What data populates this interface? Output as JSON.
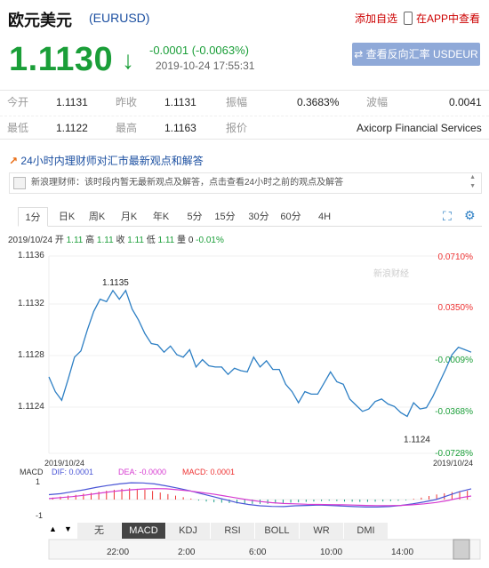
{
  "header": {
    "title": "欧元美元",
    "code": "(EURUSD)",
    "add_label": "添加自选",
    "app_label": "在APP中查看"
  },
  "quote": {
    "price": "1.1130",
    "arrow": "↓",
    "change": "-0.0001 (-0.0063%)",
    "datetime": "2019-10-24 17:55:31",
    "inverse_button": "⇄ 查看反向汇率 USDEUR"
  },
  "stats": {
    "row1": [
      {
        "label": "今开",
        "value": "1.1131"
      },
      {
        "label": "昨收",
        "value": "1.1131"
      },
      {
        "label": "振幅",
        "value": "0.3683%"
      },
      {
        "label": "波幅",
        "value": "0.0041"
      }
    ],
    "row2": [
      {
        "label": "最低",
        "value": "1.1122"
      },
      {
        "label": "最高",
        "value": "1.1163"
      },
      {
        "label": "报价",
        "value": "Axicorp Financial Services"
      }
    ]
  },
  "expert": {
    "title": "24小时内理财师对汇市最新观点和解答",
    "message": "新浪理财师：该时段内暂无最新观点及解答，点击查看24小时之前的观点及解答"
  },
  "tabs": [
    "1分",
    "日K",
    "周K",
    "月K",
    "年K",
    "5分",
    "15分",
    "30分",
    "60分",
    "4H"
  ],
  "active_tab": "1分",
  "info_bar": {
    "date": "2019/10/24",
    "open_label": "开",
    "open": "1.11",
    "high_label": "高",
    "high": "1.11",
    "close_label": "收",
    "close": "1.11",
    "low_label": "低",
    "low": "1.11",
    "volume_label": "量",
    "volume": "0",
    "change": "-0.01%"
  },
  "chart_data": {
    "type": "line",
    "ylim": [
      1.1122,
      1.1138
    ],
    "y_ticks": [
      "1.1136",
      "1.1132",
      "1.1128",
      "1.1124"
    ],
    "right_ticks": [
      "0.0710%",
      "0.0350%",
      "-0.0009%",
      "-0.0368%",
      "-0.0728%"
    ],
    "high_label": "1.1135",
    "low_label": "1.1124",
    "watermark": "新浪财经",
    "series": [
      {
        "values": [
          1.11282,
          1.1127,
          1.11263,
          1.1128,
          1.11298,
          1.11303,
          1.1132,
          1.11335,
          1.11345,
          1.11343,
          1.11352,
          1.11345,
          1.11352,
          1.11337,
          1.11328,
          1.11317,
          1.11309,
          1.11308,
          1.11302,
          1.11307,
          1.113,
          1.11298,
          1.11304,
          1.1129,
          1.11296,
          1.11291,
          1.1129,
          1.1129,
          1.11284,
          1.11289,
          1.11287,
          1.11286,
          1.11298,
          1.1129,
          1.11295,
          1.11288,
          1.11288,
          1.11276,
          1.1127,
          1.11261,
          1.1127,
          1.11268,
          1.11268,
          1.11277,
          1.11286,
          1.11278,
          1.11276,
          1.11264,
          1.11259,
          1.11254,
          1.11256,
          1.11262,
          1.11264,
          1.1126,
          1.11258,
          1.11253,
          1.1125,
          1.11261,
          1.11256,
          1.11257,
          1.11266,
          1.11277,
          1.11288,
          1.113,
          1.11306,
          1.11304,
          1.11302
        ]
      }
    ]
  },
  "macd": {
    "label": "MACD",
    "dif": "DIF: 0.0001",
    "dea": "DEA: -0.0000",
    "macd": "MACD: 0.0001",
    "date_left": "2019/10/24",
    "date_right": "2019/10/24",
    "ticks": [
      "1",
      "-1"
    ],
    "bars": [
      0.1,
      0.15,
      0.2,
      0.24,
      0.3,
      0.34,
      0.4,
      0.45,
      0.5,
      0.55,
      0.58,
      0.55,
      0.5,
      0.44,
      0.36,
      0.28,
      0.2,
      0.12,
      0.05,
      -0.05,
      -0.1,
      -0.14,
      -0.16,
      -0.18,
      -0.2,
      -0.21,
      -0.22,
      -0.22,
      -0.22,
      -0.2,
      -0.18,
      -0.16,
      -0.14,
      -0.12,
      -0.1,
      -0.08,
      -0.06,
      -0.08,
      -0.1,
      -0.11,
      -0.12,
      -0.12,
      -0.11,
      -0.1,
      -0.08,
      -0.06,
      -0.04,
      0.04,
      0.1,
      0.18,
      0.26,
      0.32,
      0.38,
      0.42,
      0.45
    ],
    "dif_line": [
      0.25,
      0.3,
      0.4,
      0.5,
      0.62,
      0.72,
      0.8,
      0.86,
      0.85,
      0.8,
      0.7,
      0.58,
      0.45,
      0.3,
      0.15,
      0.0,
      -0.15,
      -0.25,
      -0.32,
      -0.35,
      -0.36,
      -0.32,
      -0.3,
      -0.28,
      -0.3,
      -0.33,
      -0.36,
      -0.38,
      -0.38,
      -0.36,
      -0.3,
      -0.22,
      -0.12,
      0.0,
      0.2,
      0.4,
      0.55
    ],
    "dea_line": [
      0.05,
      0.1,
      0.15,
      0.22,
      0.3,
      0.38,
      0.45,
      0.5,
      0.54,
      0.56,
      0.55,
      0.5,
      0.44,
      0.36,
      0.28,
      0.18,
      0.08,
      -0.02,
      -0.1,
      -0.16,
      -0.2,
      -0.22,
      -0.24,
      -0.25,
      -0.26,
      -0.27,
      -0.28,
      -0.3,
      -0.31,
      -0.31,
      -0.3,
      -0.27,
      -0.22,
      -0.15,
      -0.05,
      0.08,
      0.18
    ]
  },
  "bottom_tabs": [
    "无",
    "MACD",
    "KDJ",
    "RSI",
    "BOLL",
    "WR",
    "DMI"
  ],
  "bottom_active": "MACD",
  "nav_ticks": [
    "22:00",
    "2:00",
    "6:00",
    "10:00",
    "14:00"
  ],
  "colors": {
    "green": "#1a9e38",
    "red": "#e33",
    "line": "#2d7fc4",
    "dif": "#4a55d6",
    "dea": "#d63ad0"
  }
}
